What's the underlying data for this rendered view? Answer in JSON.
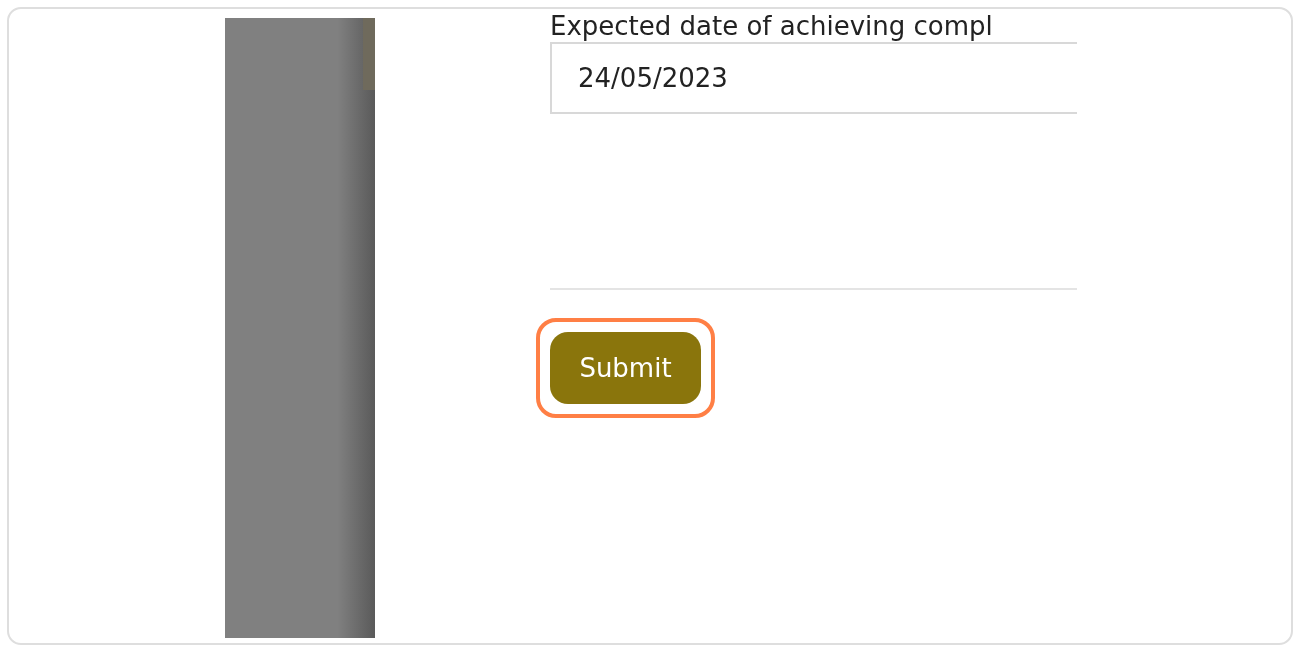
{
  "form": {
    "field_label": "Expected date of achieving compl",
    "date_field": {
      "value": "24/05/2023"
    },
    "submit_button": {
      "label": "Submit",
      "highlighted": true
    }
  }
}
